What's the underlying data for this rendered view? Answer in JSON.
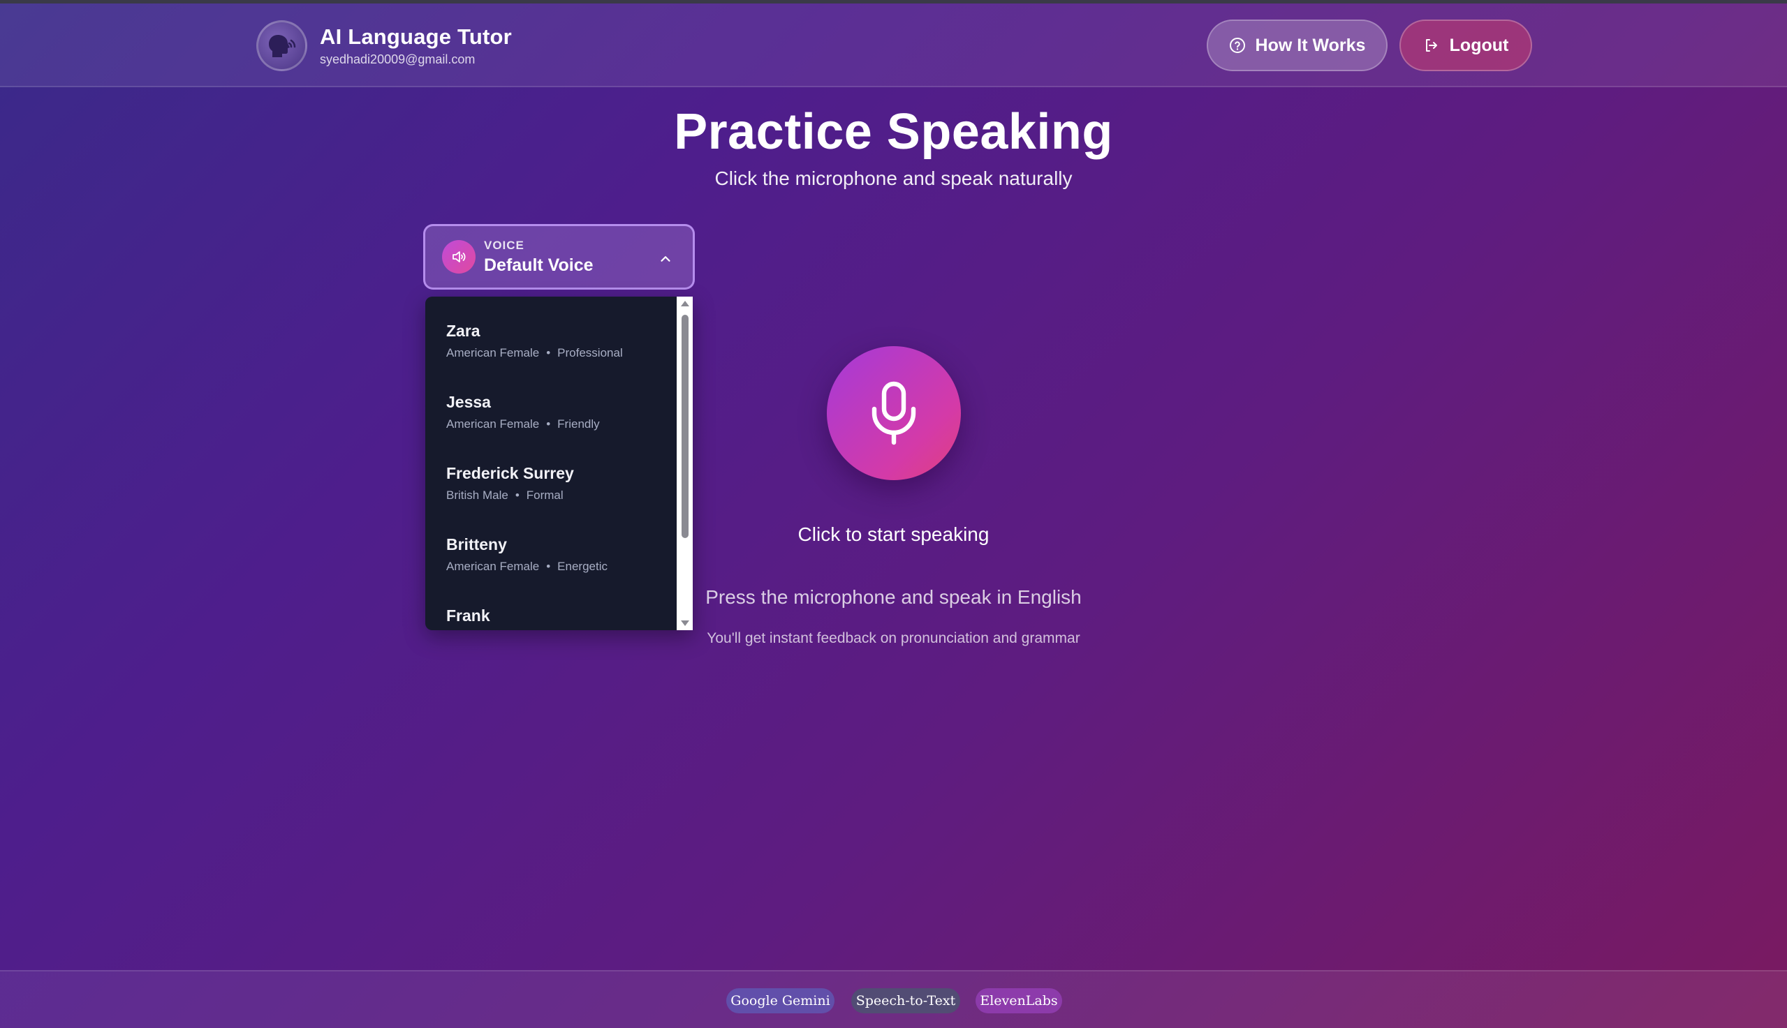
{
  "header": {
    "title": "AI Language Tutor",
    "email": "syedhadi20009@gmail.com",
    "how_it_works_label": "How It Works",
    "logout_label": "Logout"
  },
  "main": {
    "title": "Practice Speaking",
    "subtitle": "Click the microphone and speak naturally",
    "mic_caption": "Click to start speaking",
    "hint_main": "Press the microphone and speak in English",
    "hint_sub": "You'll get instant feedback on pronunciation and grammar"
  },
  "voice_selector": {
    "label": "VOICE",
    "selected": "Default Voice",
    "options": [
      {
        "name": "Zara",
        "accent": "American Female",
        "style": "Professional"
      },
      {
        "name": "Jessa",
        "accent": "American Female",
        "style": "Friendly"
      },
      {
        "name": "Frederick Surrey",
        "accent": "British Male",
        "style": "Formal"
      },
      {
        "name": "Britteny",
        "accent": "American Female",
        "style": "Energetic"
      },
      {
        "name": "Frank",
        "accent": "",
        "style": ""
      }
    ]
  },
  "footer": {
    "badges": [
      "Google Gemini",
      "Speech-to-Text",
      "ElevenLabs"
    ]
  },
  "icons": {
    "avatar": "speaking-head-icon",
    "how_it_works": "help-circle-icon",
    "logout": "logout-icon",
    "voice": "speaker-icon",
    "dropdown": "chevron-up-icon",
    "mic": "microphone-icon"
  },
  "colors": {
    "mic_gradient_start": "#a53ad8",
    "mic_gradient_end": "#e0407e",
    "dropdown_bg": "#161a2c"
  }
}
